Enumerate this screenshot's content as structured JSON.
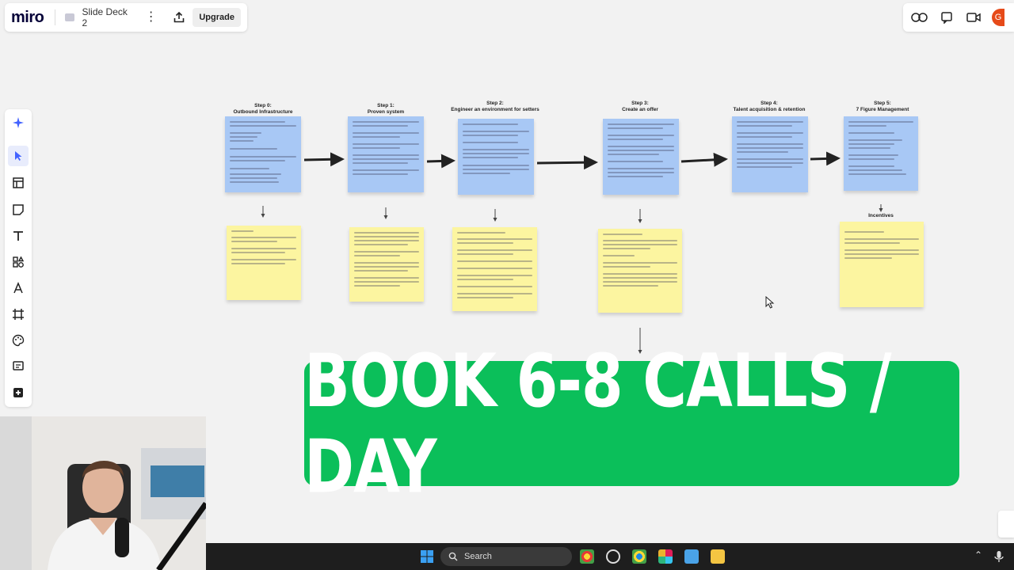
{
  "app": {
    "logo": "miro",
    "board_name": "Slide Deck 2",
    "upgrade_label": "Upgrade",
    "avatar_letter": "G"
  },
  "steps": [
    {
      "num": "Step 0:",
      "title": "Outbound Infrastructure"
    },
    {
      "num": "Step 1:",
      "title": "Proven system"
    },
    {
      "num": "Step 2:",
      "title": "Engineer an environment for setters"
    },
    {
      "num": "Step 3:",
      "title": "Create an offer"
    },
    {
      "num": "Step 4:",
      "title": "Talent acquisition & retention"
    },
    {
      "num": "Step 5:",
      "title": "7 Figure Management"
    }
  ],
  "incentives_label": "Incentives",
  "banner_text": "BOOK 6-8 CALLS / DAY",
  "taskbar": {
    "search_placeholder": "Search"
  },
  "colors": {
    "banner": "#0bbf5a",
    "note_blue": "#a8c8f5",
    "note_yellow": "#fcf5a0",
    "taskbar": "#1e1e1e"
  }
}
